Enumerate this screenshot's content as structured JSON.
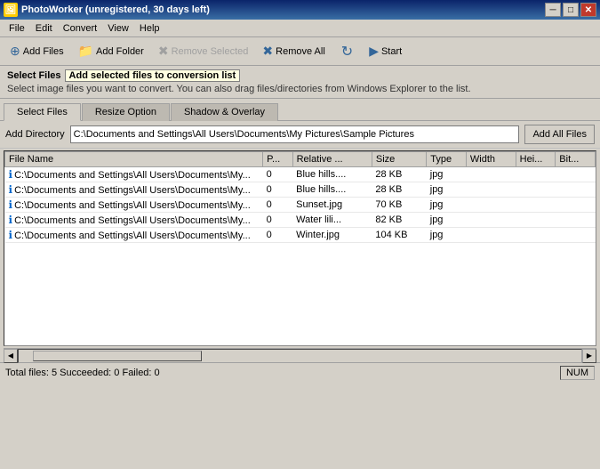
{
  "titleBar": {
    "title": "PhotoWorker (unregistered, 30 days left)",
    "icon": "🖼",
    "controls": {
      "minimize": "─",
      "restore": "□",
      "close": "✕"
    }
  },
  "menuBar": {
    "items": [
      "File",
      "Edit",
      "Convert",
      "View",
      "Help"
    ]
  },
  "toolbar": {
    "buttons": [
      {
        "id": "add-files",
        "label": "Add Files",
        "icon": "⊕",
        "enabled": true
      },
      {
        "id": "add-folder",
        "label": "Add Folder",
        "icon": "📁",
        "enabled": true
      },
      {
        "id": "remove-selected",
        "label": "Remove Selected",
        "icon": "✖",
        "enabled": false
      },
      {
        "id": "remove-all",
        "label": "Remove All",
        "icon": "✖",
        "enabled": true
      },
      {
        "id": "refresh",
        "label": "↻",
        "icon": "↻",
        "enabled": true
      },
      {
        "id": "start",
        "label": "Start",
        "icon": "▶",
        "enabled": true
      }
    ]
  },
  "infoBar": {
    "title": "Select Files",
    "tooltip": "Add selected files to conversion list",
    "description": "Select image files you want to convert. You can also drag files/directories from Windows Explorer to the list."
  },
  "tabs": [
    {
      "id": "select-files",
      "label": "Select Files",
      "active": true
    },
    {
      "id": "resize-option",
      "label": "Resize Option",
      "active": false
    },
    {
      "id": "shadow-overlay",
      "label": "Shadow & Overlay",
      "active": false
    }
  ],
  "addDirectory": {
    "label": "Add Directory",
    "value": "C:\\Documents and Settings\\All Users\\Documents\\My Pictures\\Sample Pictures",
    "buttonLabel": "Add All Files"
  },
  "fileList": {
    "columns": [
      {
        "id": "filename",
        "label": "File Name"
      },
      {
        "id": "p",
        "label": "P..."
      },
      {
        "id": "relative",
        "label": "Relative ..."
      },
      {
        "id": "size",
        "label": "Size"
      },
      {
        "id": "type",
        "label": "Type"
      },
      {
        "id": "width",
        "label": "Width"
      },
      {
        "id": "height",
        "label": "Hei..."
      },
      {
        "id": "bit",
        "label": "Bit..."
      }
    ],
    "rows": [
      {
        "filename": "C:\\Documents and Settings\\All Users\\Documents\\My...",
        "p": "0",
        "relative": "Blue hills....",
        "size": "28 KB",
        "type": "jpg",
        "width": "",
        "height": "",
        "bit": ""
      },
      {
        "filename": "C:\\Documents and Settings\\All Users\\Documents\\My...",
        "p": "0",
        "relative": "Blue hills....",
        "size": "28 KB",
        "type": "jpg",
        "width": "",
        "height": "",
        "bit": ""
      },
      {
        "filename": "C:\\Documents and Settings\\All Users\\Documents\\My...",
        "p": "0",
        "relative": "Sunset.jpg",
        "size": "70 KB",
        "type": "jpg",
        "width": "",
        "height": "",
        "bit": ""
      },
      {
        "filename": "C:\\Documents and Settings\\All Users\\Documents\\My...",
        "p": "0",
        "relative": "Water lili...",
        "size": "82 KB",
        "type": "jpg",
        "width": "",
        "height": "",
        "bit": ""
      },
      {
        "filename": "C:\\Documents and Settings\\All Users\\Documents\\My...",
        "p": "0",
        "relative": "Winter.jpg",
        "size": "104 KB",
        "type": "jpg",
        "width": "",
        "height": "",
        "bit": ""
      }
    ]
  },
  "statusBar": {
    "text": "Total files: 5 Succeeded: 0 Failed: 0",
    "numLock": "NUM"
  }
}
